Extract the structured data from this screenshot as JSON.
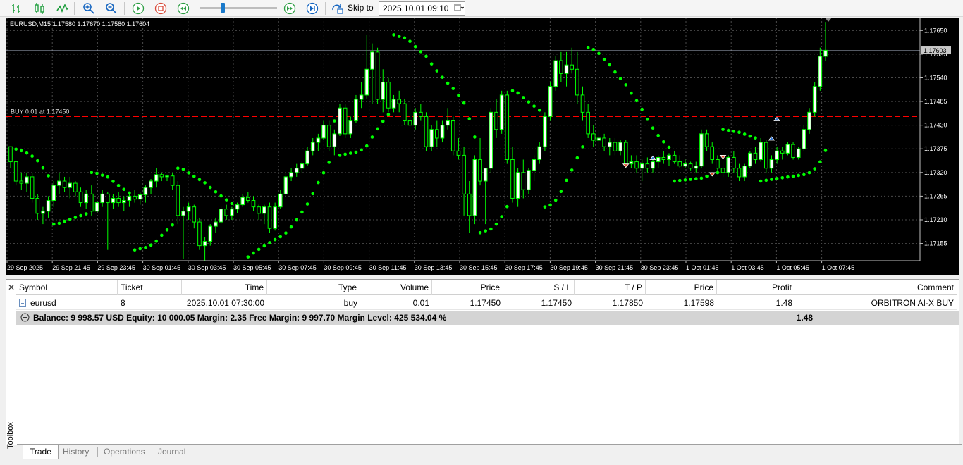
{
  "toolbar": {
    "buttons": [
      "bars-chart-icon",
      "candles-chart-icon",
      "line-chart-icon",
      "zoom-in-icon",
      "zoom-out-icon",
      "play-icon",
      "stop-icon",
      "rewind-icon",
      "fast-forward-icon",
      "skip-end-icon",
      "skip-to-icon"
    ],
    "skip_label": "Skip to",
    "skip_date": "2025.10.01 09:10"
  },
  "chart": {
    "symbol_info": "EURUSD,M15  1.17580 1.17670 1.17580 1.17604",
    "order_label": "BUY 0.01 at 1.17450",
    "current_price_tag": "1.17603",
    "y_ticks": [
      "1.17650",
      "1.17595",
      "1.17540",
      "1.17485",
      "1.17430",
      "1.17375",
      "1.17320",
      "1.17265",
      "1.17210",
      "1.17155"
    ],
    "x_ticks": [
      "29 Sep 2025",
      "29 Sep 21:45",
      "29 Sep 23:45",
      "30 Sep 01:45",
      "30 Sep 03:45",
      "30 Sep 05:45",
      "30 Sep 07:45",
      "30 Sep 09:45",
      "30 Sep 11:45",
      "30 Sep 13:45",
      "30 Sep 15:45",
      "30 Sep 17:45",
      "30 Sep 19:45",
      "30 Sep 21:45",
      "30 Sep 23:45",
      "1 Oct 01:45",
      "1 Oct 03:45",
      "1 Oct 05:45",
      "1 Oct 07:45"
    ],
    "colors": {
      "bull": "#ffffff",
      "bear": "#000000",
      "wick": "#00ff00",
      "sar": "#00ff00",
      "order_line": "#ff0000",
      "grid": "#4a4a4a"
    },
    "candles": [
      [
        1.1738,
        1.17375,
        1.1733,
        1.17345
      ],
      [
        1.17345,
        1.1734,
        1.1729,
        1.173
      ],
      [
        1.173,
        1.1732,
        1.1728,
        1.17295
      ],
      [
        1.17295,
        1.1732,
        1.17275,
        1.1731
      ],
      [
        1.1731,
        1.1732,
        1.1725,
        1.1726
      ],
      [
        1.1726,
        1.1727,
        1.1721,
        1.17225
      ],
      [
        1.17225,
        1.1724,
        1.172,
        1.1723
      ],
      [
        1.1723,
        1.17265,
        1.17215,
        1.17255
      ],
      [
        1.17255,
        1.173,
        1.1724,
        1.1729
      ],
      [
        1.1729,
        1.1732,
        1.1727,
        1.173
      ],
      [
        1.173,
        1.1731,
        1.17275,
        1.17285
      ],
      [
        1.17285,
        1.1731,
        1.1726,
        1.17295
      ],
      [
        1.17295,
        1.173,
        1.17265,
        1.17275
      ],
      [
        1.17275,
        1.17285,
        1.1724,
        1.1725
      ],
      [
        1.1725,
        1.1728,
        1.17235,
        1.1727
      ],
      [
        1.1727,
        1.1729,
        1.1722,
        1.1723
      ],
      [
        1.1723,
        1.1726,
        1.1721,
        1.1725
      ],
      [
        1.1725,
        1.1728,
        1.1724,
        1.1727
      ],
      [
        1.1727,
        1.17275,
        1.1714,
        1.1725
      ],
      [
        1.1725,
        1.1727,
        1.17235,
        1.1726
      ],
      [
        1.1726,
        1.17275,
        1.1724,
        1.1725
      ],
      [
        1.1725,
        1.17265,
        1.1723,
        1.17255
      ],
      [
        1.17255,
        1.1727,
        1.1724,
        1.17265
      ],
      [
        1.17265,
        1.1728,
        1.1725,
        1.17258
      ],
      [
        1.17258,
        1.17275,
        1.17245,
        1.17268
      ],
      [
        1.17268,
        1.1729,
        1.1725,
        1.17285
      ],
      [
        1.17285,
        1.17305,
        1.1727,
        1.173
      ],
      [
        1.173,
        1.1733,
        1.17285,
        1.17315
      ],
      [
        1.17315,
        1.1732,
        1.173,
        1.1731
      ],
      [
        1.1731,
        1.17315,
        1.173,
        1.17312
      ],
      [
        1.17312,
        1.1732,
        1.1728,
        1.1729
      ],
      [
        1.1729,
        1.173,
        1.172,
        1.1722
      ],
      [
        1.1722,
        1.1724,
        1.1712,
        1.1723
      ],
      [
        1.1723,
        1.1725,
        1.1721,
        1.1724
      ],
      [
        1.1724,
        1.17245,
        1.1719,
        1.17205
      ],
      [
        1.17205,
        1.17215,
        1.1714,
        1.1715
      ],
      [
        1.1715,
        1.1717,
        1.17115,
        1.1716
      ],
      [
        1.1716,
        1.172,
        1.1715,
        1.17195
      ],
      [
        1.17195,
        1.17215,
        1.1718,
        1.17205
      ],
      [
        1.17205,
        1.1724,
        1.172,
        1.17235
      ],
      [
        1.17235,
        1.17245,
        1.1721,
        1.1722
      ],
      [
        1.1722,
        1.1724,
        1.1721,
        1.17235
      ],
      [
        1.17235,
        1.1725,
        1.17225,
        1.17245
      ],
      [
        1.17245,
        1.1727,
        1.1724,
        1.17262
      ],
      [
        1.17262,
        1.17275,
        1.1725,
        1.17255
      ],
      [
        1.17255,
        1.17265,
        1.1723,
        1.1724
      ],
      [
        1.1724,
        1.17245,
        1.1721,
        1.17225
      ],
      [
        1.17225,
        1.17245,
        1.172,
        1.1724
      ],
      [
        1.1724,
        1.1725,
        1.1718,
        1.1719
      ],
      [
        1.1719,
        1.1725,
        1.17185,
        1.1724
      ],
      [
        1.1724,
        1.1728,
        1.17235,
        1.1727
      ],
      [
        1.1727,
        1.1732,
        1.17265,
        1.1731
      ],
      [
        1.1731,
        1.1733,
        1.173,
        1.1732
      ],
      [
        1.1732,
        1.1734,
        1.1731,
        1.1733
      ],
      [
        1.1733,
        1.17345,
        1.1732,
        1.1734
      ],
      [
        1.1734,
        1.1738,
        1.17335,
        1.1737
      ],
      [
        1.1737,
        1.174,
        1.1736,
        1.1739
      ],
      [
        1.1739,
        1.1741,
        1.1737,
        1.174
      ],
      [
        1.174,
        1.1744,
        1.17395,
        1.1743
      ],
      [
        1.1743,
        1.1744,
        1.1737,
        1.1738
      ],
      [
        1.1738,
        1.1742,
        1.1736,
        1.1741
      ],
      [
        1.1741,
        1.1748,
        1.17405,
        1.1747
      ],
      [
        1.1747,
        1.1748,
        1.174,
        1.1741
      ],
      [
        1.1741,
        1.1745,
        1.174,
        1.1744
      ],
      [
        1.1744,
        1.175,
        1.17435,
        1.1749
      ],
      [
        1.1749,
        1.1753,
        1.1747,
        1.175
      ],
      [
        1.175,
        1.1764,
        1.1749,
        1.1756
      ],
      [
        1.1756,
        1.1762,
        1.1748,
        1.176
      ],
      [
        1.176,
        1.1761,
        1.1748,
        1.1749
      ],
      [
        1.1749,
        1.1756,
        1.1746,
        1.1753
      ],
      [
        1.1753,
        1.1754,
        1.1746,
        1.1747
      ],
      [
        1.1747,
        1.175,
        1.1746,
        1.1749
      ],
      [
        1.1749,
        1.1751,
        1.1746,
        1.1748
      ],
      [
        1.1748,
        1.1749,
        1.1743,
        1.1744
      ],
      [
        1.1744,
        1.1748,
        1.1742,
        1.1743
      ],
      [
        1.1743,
        1.1747,
        1.1742,
        1.1746
      ],
      [
        1.1746,
        1.1748,
        1.1744,
        1.1745
      ],
      [
        1.1745,
        1.1746,
        1.1737,
        1.1738
      ],
      [
        1.1738,
        1.1743,
        1.1737,
        1.1742
      ],
      [
        1.1742,
        1.1744,
        1.1738,
        1.174
      ],
      [
        1.174,
        1.1744,
        1.1739,
        1.1743
      ],
      [
        1.1743,
        1.1747,
        1.1742,
        1.1744
      ],
      [
        1.1744,
        1.1745,
        1.1736,
        1.1737
      ],
      [
        1.1737,
        1.174,
        1.1735,
        1.1736
      ],
      [
        1.1736,
        1.1738,
        1.1722,
        1.1727
      ],
      [
        1.1727,
        1.173,
        1.1718,
        1.1722
      ],
      [
        1.1722,
        1.1736,
        1.172,
        1.1735
      ],
      [
        1.1735,
        1.174,
        1.1729,
        1.173
      ],
      [
        1.173,
        1.1733,
        1.172,
        1.1733
      ],
      [
        1.1733,
        1.1747,
        1.1732,
        1.1746
      ],
      [
        1.1746,
        1.1749,
        1.174,
        1.1742
      ],
      [
        1.1742,
        1.1751,
        1.1741,
        1.175
      ],
      [
        1.175,
        1.1751,
        1.1734,
        1.1735
      ],
      [
        1.1735,
        1.1738,
        1.1725,
        1.1726
      ],
      [
        1.1726,
        1.1733,
        1.1724,
        1.1732
      ],
      [
        1.1732,
        1.1735,
        1.1726,
        1.1728
      ],
      [
        1.1728,
        1.1733,
        1.1727,
        1.17325
      ],
      [
        1.17325,
        1.1736,
        1.173,
        1.1735
      ],
      [
        1.1735,
        1.1739,
        1.1734,
        1.1738
      ],
      [
        1.1738,
        1.1746,
        1.1737,
        1.1745
      ],
      [
        1.1745,
        1.1753,
        1.1744,
        1.1752
      ],
      [
        1.1752,
        1.1759,
        1.1751,
        1.1758
      ],
      [
        1.1758,
        1.176,
        1.1753,
        1.1755
      ],
      [
        1.1755,
        1.176,
        1.1752,
        1.1757
      ],
      [
        1.1757,
        1.1761,
        1.1755,
        1.1756
      ],
      [
        1.1756,
        1.176,
        1.1748,
        1.175
      ],
      [
        1.175,
        1.1752,
        1.1744,
        1.1746
      ],
      [
        1.1746,
        1.1748,
        1.174,
        1.1741
      ],
      [
        1.1741,
        1.1743,
        1.1738,
        1.17395
      ],
      [
        1.17395,
        1.1742,
        1.1737,
        1.174
      ],
      [
        1.174,
        1.1741,
        1.1737,
        1.1738
      ],
      [
        1.1738,
        1.174,
        1.1736,
        1.1739
      ],
      [
        1.1739,
        1.174,
        1.1736,
        1.1737
      ],
      [
        1.1737,
        1.17395,
        1.1736,
        1.1739
      ],
      [
        1.1739,
        1.17395,
        1.1733,
        1.1734
      ],
      [
        1.1734,
        1.1736,
        1.1733,
        1.17345
      ],
      [
        1.17345,
        1.1736,
        1.1732,
        1.1733
      ],
      [
        1.1733,
        1.1735,
        1.173,
        1.1734
      ],
      [
        1.1734,
        1.17355,
        1.1732,
        1.1733
      ],
      [
        1.1733,
        1.1735,
        1.1732,
        1.17345
      ],
      [
        1.17345,
        1.1736,
        1.1733,
        1.17355
      ],
      [
        1.17355,
        1.1737,
        1.1734,
        1.1735
      ],
      [
        1.1735,
        1.17365,
        1.17335,
        1.1736
      ],
      [
        1.1736,
        1.1737,
        1.1734,
        1.17345
      ],
      [
        1.17345,
        1.1736,
        1.1733,
        1.17335
      ],
      [
        1.17335,
        1.1735,
        1.1733,
        1.1734
      ],
      [
        1.1734,
        1.17345,
        1.17325,
        1.1733
      ],
      [
        1.1733,
        1.17345,
        1.1732,
        1.17335
      ],
      [
        1.17335,
        1.1742,
        1.1733,
        1.1741
      ],
      [
        1.1741,
        1.1742,
        1.1737,
        1.1738
      ],
      [
        1.1738,
        1.1739,
        1.1734,
        1.1735
      ],
      [
        1.1735,
        1.1736,
        1.1732,
        1.1733
      ],
      [
        1.1733,
        1.17345,
        1.1731,
        1.1732
      ],
      [
        1.1732,
        1.1736,
        1.1731,
        1.17355
      ],
      [
        1.17355,
        1.1737,
        1.1732,
        1.1733
      ],
      [
        1.1733,
        1.1734,
        1.173,
        1.1731
      ],
      [
        1.1731,
        1.1734,
        1.173,
        1.17335
      ],
      [
        1.17335,
        1.1737,
        1.1733,
        1.17365
      ],
      [
        1.17365,
        1.1738,
        1.1734,
        1.1735
      ],
      [
        1.1735,
        1.174,
        1.17345,
        1.1739
      ],
      [
        1.1739,
        1.17395,
        1.1732,
        1.1733
      ],
      [
        1.1733,
        1.1736,
        1.1732,
        1.1735
      ],
      [
        1.1735,
        1.1738,
        1.1734,
        1.1737
      ],
      [
        1.1737,
        1.1738,
        1.1735,
        1.17365
      ],
      [
        1.17365,
        1.1739,
        1.1736,
        1.17385
      ],
      [
        1.17385,
        1.1739,
        1.1735,
        1.17355
      ],
      [
        1.17355,
        1.1738,
        1.1735,
        1.17375
      ],
      [
        1.17375,
        1.1743,
        1.1737,
        1.1742
      ],
      [
        1.1742,
        1.1747,
        1.1741,
        1.1746
      ],
      [
        1.1746,
        1.1753,
        1.1745,
        1.1752
      ],
      [
        1.1752,
        1.1761,
        1.1751,
        1.1759
      ],
      [
        1.1759,
        1.1767,
        1.1758,
        1.17604
      ]
    ]
  },
  "trade_table": {
    "columns": [
      "Symbol",
      "Ticket",
      "Time",
      "Type",
      "Volume",
      "Price",
      "S / L",
      "T / P",
      "Price",
      "Profit",
      "Comment"
    ],
    "rows": [
      [
        "eurusd",
        "8",
        "2025.10.01 07:30:00",
        "buy",
        "0.01",
        "1.17450",
        "1.17450",
        "1.17850",
        "1.17598",
        "1.48",
        "ORBITRON AI-X BUY"
      ]
    ],
    "summary": "Balance: 9 998.57 USD  Equity: 10 000.05  Margin: 2.35  Free Margin: 9 997.70  Margin Level: 425 534.04 %",
    "summary_profit": "1.48"
  },
  "panel_side_label": "Toolbox",
  "tabs": [
    "Trade",
    "History",
    "Operations",
    "Journal"
  ],
  "active_tab": "Trade"
}
